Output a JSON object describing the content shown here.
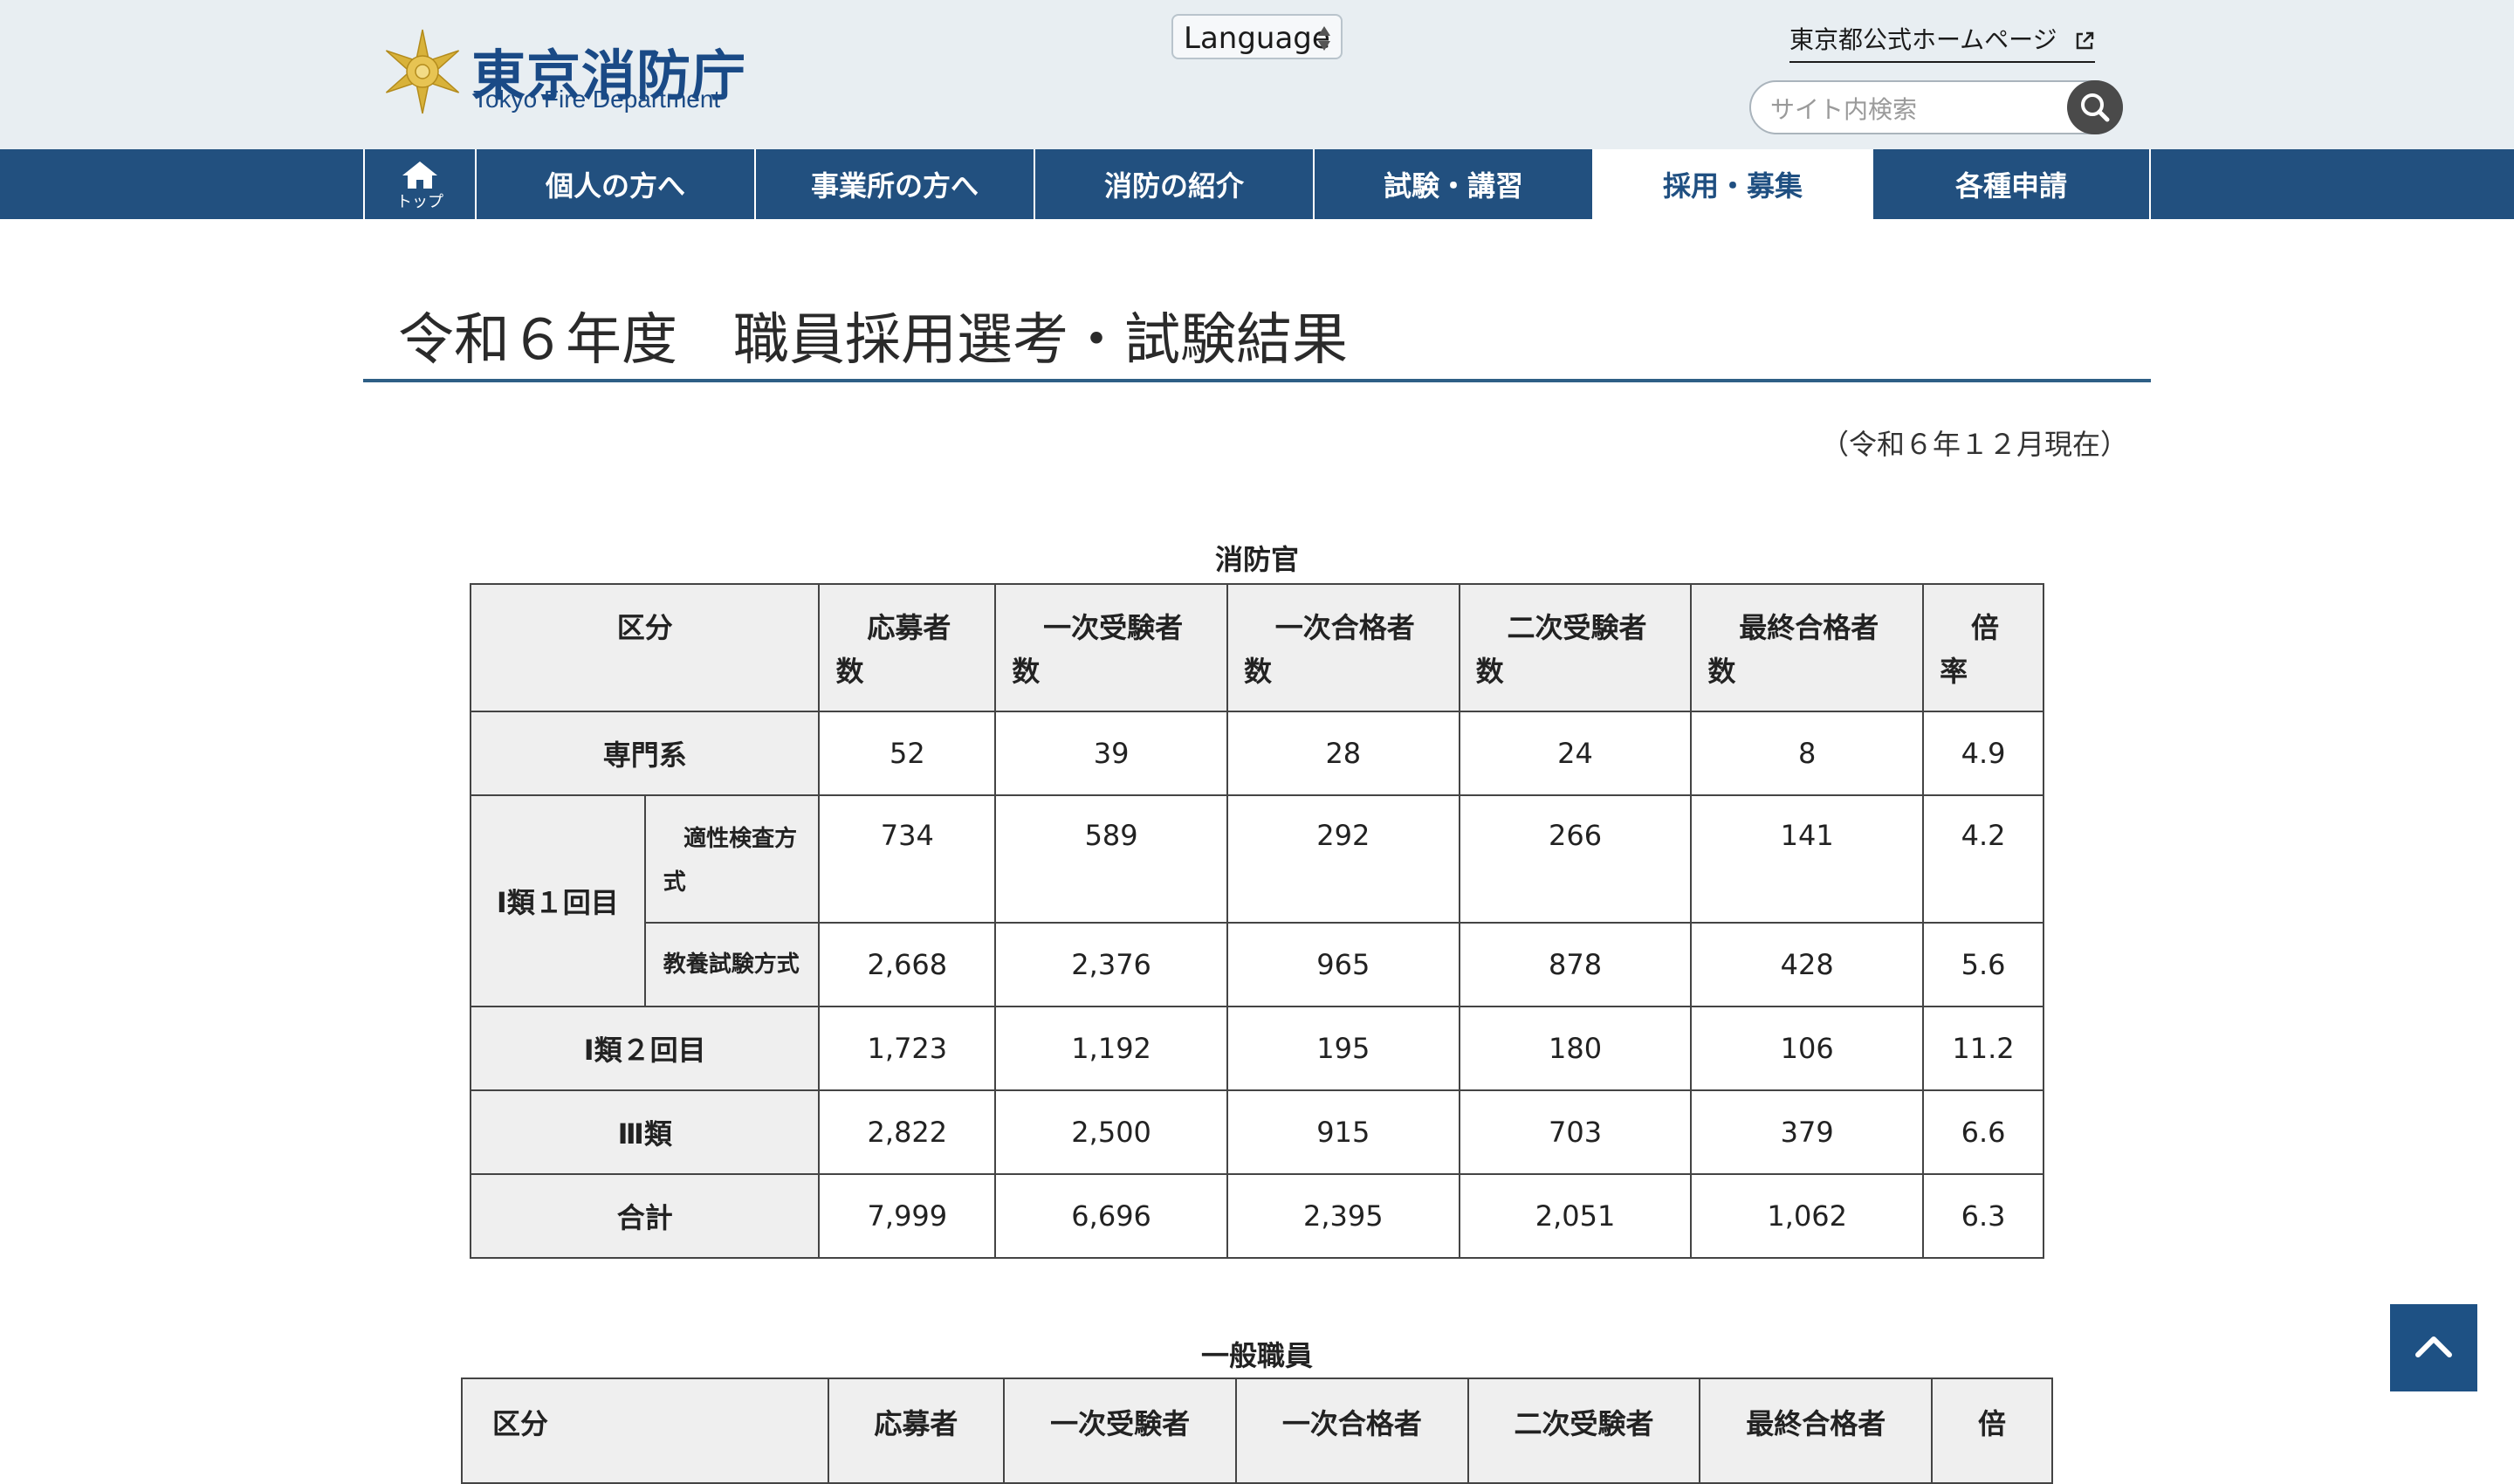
{
  "header": {
    "logo_jp": "東京消防庁",
    "logo_en": "Tokyo Fire Department",
    "language_label": "Language",
    "tmg_link": "東京都公式ホームページ",
    "search_placeholder": "サイト内検索"
  },
  "nav": {
    "home_label": "トップ",
    "items": [
      {
        "label": "個人の方へ"
      },
      {
        "label": "事業所の方へ"
      },
      {
        "label": "消防の紹介"
      },
      {
        "label": "試験・講習"
      },
      {
        "label": "採用・募集",
        "active": true
      },
      {
        "label": "各種申請"
      }
    ]
  },
  "page": {
    "title": "令和６年度　職員採用選考・試験結果",
    "as_of": "（令和６年１２月現在）"
  },
  "table1": {
    "caption": "消防官",
    "headers": {
      "category": "区分",
      "cols": [
        {
          "l1": "応募者",
          "l2": "数"
        },
        {
          "l1": "一次受験者",
          "l2": "数"
        },
        {
          "l1": "一次合格者",
          "l2": "数"
        },
        {
          "l1": "二次受験者",
          "l2": "数"
        },
        {
          "l1": "最終合格者",
          "l2": "数"
        },
        {
          "l1": "倍",
          "l2": "率"
        }
      ]
    },
    "rows": [
      {
        "label": "専門系",
        "values": [
          "52",
          "39",
          "28",
          "24",
          "8",
          "4.9"
        ]
      },
      {
        "group": "Ⅰ類１回目",
        "sub_l1": "適性検査方",
        "sub_l2": "式",
        "values": [
          "734",
          "589",
          "292",
          "266",
          "141",
          "4.2"
        ]
      },
      {
        "sub": "教養試験方式",
        "values": [
          "2,668",
          "2,376",
          "965",
          "878",
          "428",
          "5.6"
        ]
      },
      {
        "label": "Ⅰ類２回目",
        "values": [
          "1,723",
          "1,192",
          "195",
          "180",
          "106",
          "11.2"
        ]
      },
      {
        "label": "Ⅲ類",
        "values": [
          "2,822",
          "2,500",
          "915",
          "703",
          "379",
          "6.6"
        ]
      },
      {
        "label": "合計",
        "values": [
          "7,999",
          "6,696",
          "2,395",
          "2,051",
          "1,062",
          "6.3"
        ]
      }
    ]
  },
  "table2": {
    "caption": "一般職員",
    "headers": {
      "category": "区分",
      "cols": [
        "応募者",
        "一次受験者",
        "一次合格者",
        "二次受験者",
        "最終合格者",
        "倍"
      ]
    }
  },
  "colors": {
    "nav_bg": "#22507f",
    "header_bg": "#e8eef2",
    "logo_blue": "#1a4a86",
    "back_to_top": "#1e5184"
  }
}
